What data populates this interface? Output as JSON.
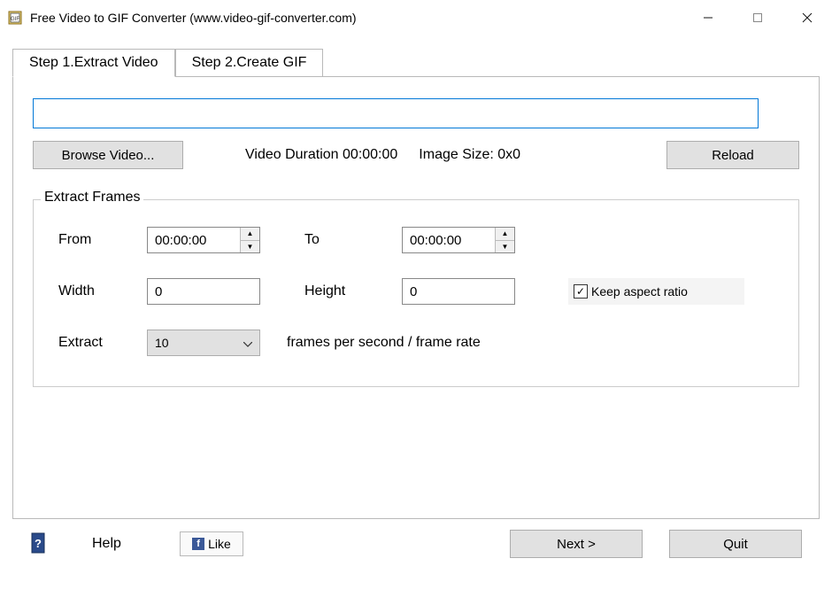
{
  "window": {
    "title": "Free Video to GIF Converter (www.video-gif-converter.com)"
  },
  "tabs": [
    {
      "label": "Step 1.Extract Video",
      "active": true
    },
    {
      "label": "Step 2.Create GIF",
      "active": false
    }
  ],
  "path_value": "",
  "buttons": {
    "browse": "Browse Video...",
    "reload": "Reload",
    "next": "Next >",
    "quit": "Quit",
    "like": "Like",
    "help": "Help"
  },
  "info": {
    "duration_label": "Video Duration",
    "duration_value": "00:00:00",
    "imagesize_label": "Image Size:",
    "imagesize_value": "0x0"
  },
  "fieldset": {
    "legend": "Extract Frames",
    "from_label": "From",
    "from_value": "00:00:00",
    "to_label": "To",
    "to_value": "00:00:00",
    "width_label": "Width",
    "width_value": "0",
    "height_label": "Height",
    "height_value": "0",
    "keep_aspect_label": "Keep aspect ratio",
    "keep_aspect_checked": true,
    "extract_label": "Extract",
    "extract_value": "10",
    "extract_suffix": "frames per second / frame rate"
  }
}
